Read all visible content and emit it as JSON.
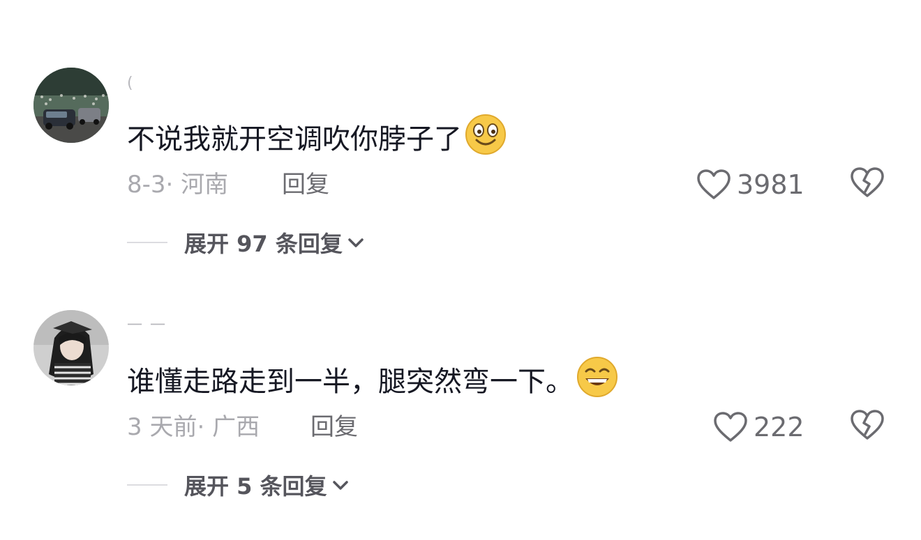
{
  "comments": [
    {
      "username": "(",
      "text": "不说我就开空调吹你脖子了",
      "emoji": "smiling-face-emoji",
      "date": "8-3",
      "region": "· 河南",
      "reply_label": "回复",
      "likes": "3981",
      "expand_label": "展开 97 条回复"
    },
    {
      "username": "一 一",
      "text": "谁懂走路走到一半，腿突然弯一下。",
      "emoji": "grinning-face-emoji",
      "date": "3 天前",
      "region": "· 广西",
      "reply_label": "回复",
      "likes": "222",
      "expand_label": "展开 5 条回复"
    }
  ],
  "colors": {
    "text_primary": "#161823",
    "text_secondary": "#a9a9ae",
    "action_gray": "#6b6b70",
    "emoji_yellow": "#f7c948"
  }
}
